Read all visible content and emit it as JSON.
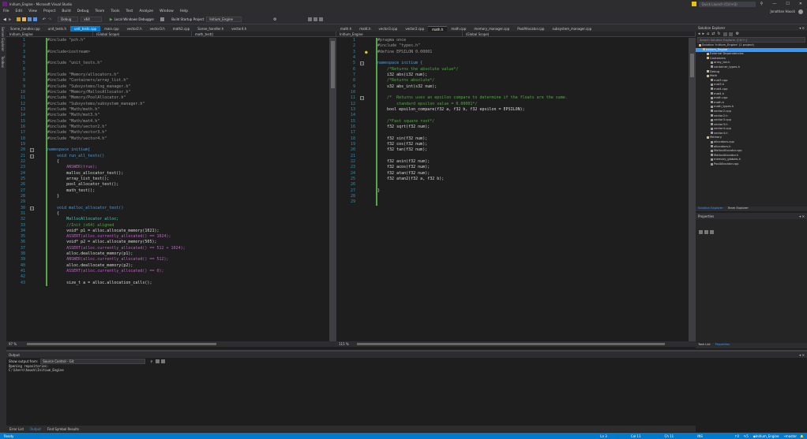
{
  "window": {
    "title": "Initium_Engine - Microsoft Visual Studio",
    "quick_launch": "Quick Launch (Ctrl+Q)",
    "user": "Jonathan Hauck"
  },
  "menu": [
    "File",
    "Edit",
    "View",
    "Project",
    "Build",
    "Debug",
    "Team",
    "Tools",
    "Test",
    "Analyze",
    "Window",
    "Help"
  ],
  "toolbar": {
    "config": "Debug",
    "platform": "x64",
    "debugger": "Local Windows Debugger",
    "startup": "Build Startup Project",
    "project": "Initium_Engine"
  },
  "left_panel_tabs": [
    "Server Explorer",
    "Toolbox"
  ],
  "left_editor": {
    "tabs": [
      {
        "label": "Scene_handler.cpp",
        "active": false
      },
      {
        "label": "unit_tests.h",
        "active": false
      },
      {
        "label": "unit_tests.cpp",
        "active": true
      },
      {
        "label": "main.cpp",
        "active": false
      },
      {
        "label": "vector2.h",
        "active": false
      },
      {
        "label": "vector3.h",
        "active": false
      },
      {
        "label": "math2.cpp",
        "active": false
      },
      {
        "label": "Scene_handler.h",
        "active": false
      },
      {
        "label": "vector4.h",
        "active": false
      }
    ],
    "nav": [
      "Initium_Engine",
      "(Global Scope)",
      "math_test()"
    ],
    "zoom": "97 %",
    "lines": [
      {
        "n": "1",
        "t": "#include \"pch.h\"",
        "c": "pp"
      },
      {
        "n": "2",
        "t": "",
        "c": "plain"
      },
      {
        "n": "3",
        "t": "#include<iostream>",
        "c": "pp"
      },
      {
        "n": "4",
        "t": "",
        "c": "plain"
      },
      {
        "n": "5",
        "t": "#include \"unit_tests.h\"",
        "c": "pp"
      },
      {
        "n": "6",
        "t": "",
        "c": "plain"
      },
      {
        "n": "7",
        "t": "#include \"Memory/allocators.h\"",
        "c": "pp"
      },
      {
        "n": "8",
        "t": "#include \"Containers/array_list.h\"",
        "c": "pp"
      },
      {
        "n": "9",
        "t": "#include \"Subsystems/log_manager.h\"",
        "c": "pp"
      },
      {
        "n": "10",
        "t": "#include \"Memory/MallocAllocator.h\"",
        "c": "pp"
      },
      {
        "n": "11",
        "t": "#include \"Memory/PoolAllocator.h\"",
        "c": "pp"
      },
      {
        "n": "12",
        "t": "#include \"Subsystems/subsystem_manager.h\"",
        "c": "pp"
      },
      {
        "n": "13",
        "t": "#include \"Math/math.h\"",
        "c": "pp"
      },
      {
        "n": "14",
        "t": "#include \"Math/mat3.h\"",
        "c": "pp"
      },
      {
        "n": "15",
        "t": "#include \"Math/mat4.h\"",
        "c": "pp"
      },
      {
        "n": "16",
        "t": "#include \"Math/vector2.h\"",
        "c": "pp"
      },
      {
        "n": "17",
        "t": "#include \"Math/vector3.h\"",
        "c": "pp"
      },
      {
        "n": "18",
        "t": "#include \"Math/vector4.h\"",
        "c": "pp"
      },
      {
        "n": "19",
        "t": "",
        "c": "plain"
      },
      {
        "n": "20",
        "t": "namespace initium{",
        "c": "kw",
        "fold": true
      },
      {
        "n": "21",
        "t": "    void run_all_tests()",
        "c": "kw",
        "fold": true
      },
      {
        "n": "22",
        "t": "    {",
        "c": "plain"
      },
      {
        "n": "23",
        "t": "        ANSWER(true);",
        "c": "mac"
      },
      {
        "n": "24",
        "t": "        malloc_allocator_test();",
        "c": "plain"
      },
      {
        "n": "25",
        "t": "        array_list_test();",
        "c": "plain"
      },
      {
        "n": "26",
        "t": "        pool_allocator_test();",
        "c": "plain"
      },
      {
        "n": "27",
        "t": "        math_test();",
        "c": "plain"
      },
      {
        "n": "28",
        "t": "    }",
        "c": "plain"
      },
      {
        "n": "29",
        "t": "",
        "c": "plain"
      },
      {
        "n": "30",
        "t": "    void malloc_allocator_test()",
        "c": "kw",
        "fold": true
      },
      {
        "n": "31",
        "t": "    {",
        "c": "plain"
      },
      {
        "n": "32",
        "t": "        MallocAllocator alloc;",
        "c": "ty"
      },
      {
        "n": "33",
        "t": "        //Init (x64) aligned",
        "c": "cm"
      },
      {
        "n": "34",
        "t": "        void* p1 = alloc.allocate_memory(1021);",
        "c": "plain"
      },
      {
        "n": "35",
        "t": "        ASSERT(alloc.currently_allocated() == 1024);",
        "c": "mac"
      },
      {
        "n": "36",
        "t": "        void* p2 = alloc.allocate_memory(505);",
        "c": "plain"
      },
      {
        "n": "37",
        "t": "        ASSERT(alloc.currently_allocated() == 512 + 1024);",
        "c": "mac"
      },
      {
        "n": "38",
        "t": "        alloc.deallocate_memory(p1);",
        "c": "plain"
      },
      {
        "n": "39",
        "t": "        ANSWER(alloc.currently_allocated() == 512);",
        "c": "mac"
      },
      {
        "n": "40",
        "t": "        alloc.deallocate_memory(p2);",
        "c": "plain"
      },
      {
        "n": "41",
        "t": "        ASSERT(alloc.currently_allocated() == 0);",
        "c": "mac"
      },
      {
        "n": "42",
        "t": "",
        "c": "plain"
      },
      {
        "n": "43",
        "t": "        size_t a = alloc.allocation_calls();",
        "c": "plain"
      }
    ]
  },
  "right_editor": {
    "tabs": [
      {
        "label": "math.h",
        "active": false
      },
      {
        "label": "mat4.h",
        "active": false
      },
      {
        "label": "vector3.cpp",
        "active": false
      },
      {
        "label": "vector2.cpp",
        "active": false
      },
      {
        "label": "math.h",
        "active": true
      },
      {
        "label": "math.cpp",
        "active": false
      },
      {
        "label": "memory_manager.cpp",
        "active": false
      },
      {
        "label": "PoolAllocator.cpp",
        "active": false
      },
      {
        "label": "subsystem_manager.cpp",
        "active": false
      }
    ],
    "nav": [
      "Initium_Engine",
      "(Global Scope)"
    ],
    "zoom": "115 %",
    "lines": [
      {
        "n": "1",
        "t": "#pragma once",
        "c": "pp"
      },
      {
        "n": "2",
        "t": "#include \"types.h\"",
        "c": "pp"
      },
      {
        "n": "3",
        "t": "#define EPSILON 0.00001",
        "c": "pp",
        "bulb": true
      },
      {
        "n": "4",
        "t": "",
        "c": "plain"
      },
      {
        "n": "5",
        "t": "namespace initium {",
        "c": "kw",
        "fold": true
      },
      {
        "n": "6",
        "t": "    /*Returns the absolute value*/",
        "c": "cm"
      },
      {
        "n": "7",
        "t": "    i32 abs(i32 num);",
        "c": "plain"
      },
      {
        "n": "8",
        "t": "    /*Returns absolute*/",
        "c": "cm"
      },
      {
        "n": "9",
        "t": "    s32 abs_int(s32 num);",
        "c": "plain"
      },
      {
        "n": "10",
        "t": "",
        "c": "plain"
      },
      {
        "n": "11",
        "t": "    /*  Returns uses an epsilon compare to determine if the floats are the same.",
        "c": "cm",
        "fold": true
      },
      {
        "n": "12",
        "t": "        standard epsilon value = 0.00001*/",
        "c": "cm"
      },
      {
        "n": "13",
        "t": "    bool epsilon_compare(f32 a, f32 b, f32 epsilon = EPSILON);",
        "c": "plain"
      },
      {
        "n": "14",
        "t": "",
        "c": "plain"
      },
      {
        "n": "15",
        "t": "    /*Fast square root*/",
        "c": "cm"
      },
      {
        "n": "16",
        "t": "    f32 sqrt(f32 num);",
        "c": "plain"
      },
      {
        "n": "17",
        "t": "",
        "c": "plain"
      },
      {
        "n": "18",
        "t": "    f32 sin(f32 num);",
        "c": "plain"
      },
      {
        "n": "19",
        "t": "    f32 cos(f32 num);",
        "c": "plain"
      },
      {
        "n": "20",
        "t": "    f32 tan(f32 num);",
        "c": "plain"
      },
      {
        "n": "21",
        "t": "",
        "c": "plain"
      },
      {
        "n": "22",
        "t": "    f32 asin(f32 num);",
        "c": "plain"
      },
      {
        "n": "23",
        "t": "    f32 acos(f32 num);",
        "c": "plain"
      },
      {
        "n": "24",
        "t": "    f32 atan(f32 num);",
        "c": "plain"
      },
      {
        "n": "25",
        "t": "    f32 atan2(f32 a, f32 b);",
        "c": "plain"
      },
      {
        "n": "26",
        "t": "",
        "c": "plain"
      },
      {
        "n": "27",
        "t": "}",
        "c": "plain"
      },
      {
        "n": "28",
        "t": "",
        "c": "plain"
      },
      {
        "n": "29",
        "t": "",
        "c": "plain"
      }
    ]
  },
  "solution_explorer": {
    "title": "Solution Explorer",
    "search_placeholder": "Search Solution Explorer (Ctrl+;)",
    "items": [
      {
        "label": "Solution 'Initium_Engine' (1 project)",
        "indent": 0,
        "sel": false
      },
      {
        "label": "Initium_Engine",
        "indent": 1,
        "sel": true
      },
      {
        "label": "External Dependencies",
        "indent": 2,
        "sel": false
      },
      {
        "label": "Containers",
        "indent": 2,
        "sel": false
      },
      {
        "label": "array_list.h",
        "indent": 3,
        "sel": false
      },
      {
        "label": "container_types.h",
        "indent": 3,
        "sel": false
      },
      {
        "label": "Debug",
        "indent": 2,
        "sel": false
      },
      {
        "label": "Math",
        "indent": 2,
        "sel": false
      },
      {
        "label": "mat3.cpp",
        "indent": 3,
        "sel": false
      },
      {
        "label": "mat3.h",
        "indent": 3,
        "sel": false
      },
      {
        "label": "mat4.cpp",
        "indent": 3,
        "sel": false
      },
      {
        "label": "mat4.h",
        "indent": 3,
        "sel": false
      },
      {
        "label": "math.cpp",
        "indent": 3,
        "sel": false
      },
      {
        "label": "math.h",
        "indent": 3,
        "sel": false
      },
      {
        "label": "math_types.h",
        "indent": 3,
        "sel": false
      },
      {
        "label": "vector2.cpp",
        "indent": 3,
        "sel": false
      },
      {
        "label": "vector2.h",
        "indent": 3,
        "sel": false
      },
      {
        "label": "vector3.cpp",
        "indent": 3,
        "sel": false
      },
      {
        "label": "vector3.h",
        "indent": 3,
        "sel": false
      },
      {
        "label": "vector4.cpp",
        "indent": 3,
        "sel": false
      },
      {
        "label": "vector4.h",
        "indent": 3,
        "sel": false
      },
      {
        "label": "Memory",
        "indent": 2,
        "sel": false
      },
      {
        "label": "allocators.cpp",
        "indent": 3,
        "sel": false
      },
      {
        "label": "allocators.h",
        "indent": 3,
        "sel": false
      },
      {
        "label": "MallocAllocator.cpp",
        "indent": 3,
        "sel": false
      },
      {
        "label": "MallocAllocator.h",
        "indent": 3,
        "sel": false
      },
      {
        "label": "memory_globals.h",
        "indent": 3,
        "sel": false
      },
      {
        "label": "PoolAllocator.cpp",
        "indent": 3,
        "sel": false
      }
    ],
    "bottom_tabs": [
      "Solution Explorer",
      "Team Explorer"
    ]
  },
  "properties": {
    "title": "Properties",
    "bottom_tabs": [
      "Task List",
      "Properties"
    ]
  },
  "output": {
    "title": "Output",
    "show_from_label": "Show output from:",
    "show_from_value": "Source Control - Git",
    "lines": [
      "Opening repositories:",
      "C:\\Users\\hauck\\Initium_Engine"
    ]
  },
  "bottom_tabs": [
    "Error List",
    "Output",
    "Find Symbol Results"
  ],
  "status": {
    "left": "Ready",
    "ln": "Ln 3",
    "col": "Col 11",
    "ch": "Ch 11",
    "ins": "INS",
    "errors": "0",
    "changes": "5",
    "repo": "Initium_Engine",
    "branch": "master"
  },
  "colors": {
    "accent": "#007acc",
    "background": "#1e1e1e",
    "chrome": "#2d2d30"
  }
}
